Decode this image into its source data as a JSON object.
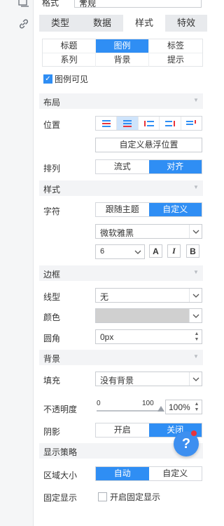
{
  "top_select": {
    "label": "格式",
    "value": "常规"
  },
  "main_tabs": [
    "类型",
    "数据",
    "样式",
    "特效"
  ],
  "sub_tabs": [
    "标题",
    "图例",
    "标签",
    "系列",
    "背景",
    "提示"
  ],
  "legend_visible": {
    "label": "图例可见",
    "checked": true
  },
  "sections": {
    "layout": "布局",
    "style": "样式",
    "border": "边框",
    "background": "背景",
    "display": "显示策略"
  },
  "layout": {
    "position_label": "位置",
    "align_icons": [
      "align-top-left-icon",
      "align-top-center-icon",
      "align-left-icon",
      "align-bottom-icon",
      "align-right-icon"
    ],
    "custom_float": "自定义悬浮位置",
    "arrange_label": "排列",
    "arrange_options": [
      "流式",
      "对齐"
    ]
  },
  "style": {
    "font_label": "字符",
    "font_options": [
      "跟随主题",
      "自定义"
    ],
    "font_family": "微软雅黑",
    "font_size": "6",
    "bold": "A",
    "italic": "I",
    "bold2": "B"
  },
  "border": {
    "line_label": "线型",
    "line_value": "无",
    "color_label": "颜色",
    "radius_label": "圆角",
    "radius_value": "0px"
  },
  "background": {
    "fill_label": "填充",
    "fill_value": "没有背景",
    "opacity_label": "不透明度",
    "slider_min": "0",
    "slider_max": "100",
    "opacity_value": "100%",
    "shadow_label": "阴影",
    "shadow_options": [
      "开启",
      "关闭"
    ]
  },
  "display": {
    "size_label": "区域大小",
    "size_options": [
      "自动",
      "自定义"
    ],
    "fixed_label": "固定显示",
    "fixed_checkbox": "开启固定显示"
  },
  "help": "?",
  "colors": {
    "accent": "#2f8ef4",
    "section_bg": "#f3f4f6",
    "color_swatch": "#d0d0d0"
  }
}
